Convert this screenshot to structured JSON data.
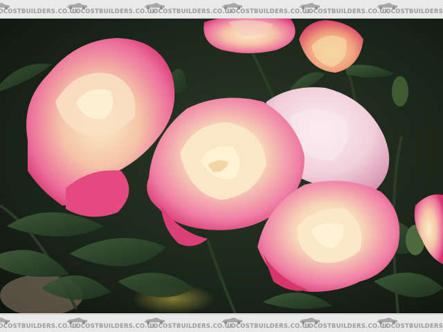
{
  "watermark": {
    "text": "LOCOSTBUILDERS.CO.UK",
    "tiles_per_band": 7
  },
  "photo": {
    "subject": "pink and cream roses",
    "colors": {
      "background": "#152016",
      "leaf": "#2f4a2c",
      "petal_pink": "#e8487e",
      "petal_cream": "#f6e4b4"
    }
  }
}
